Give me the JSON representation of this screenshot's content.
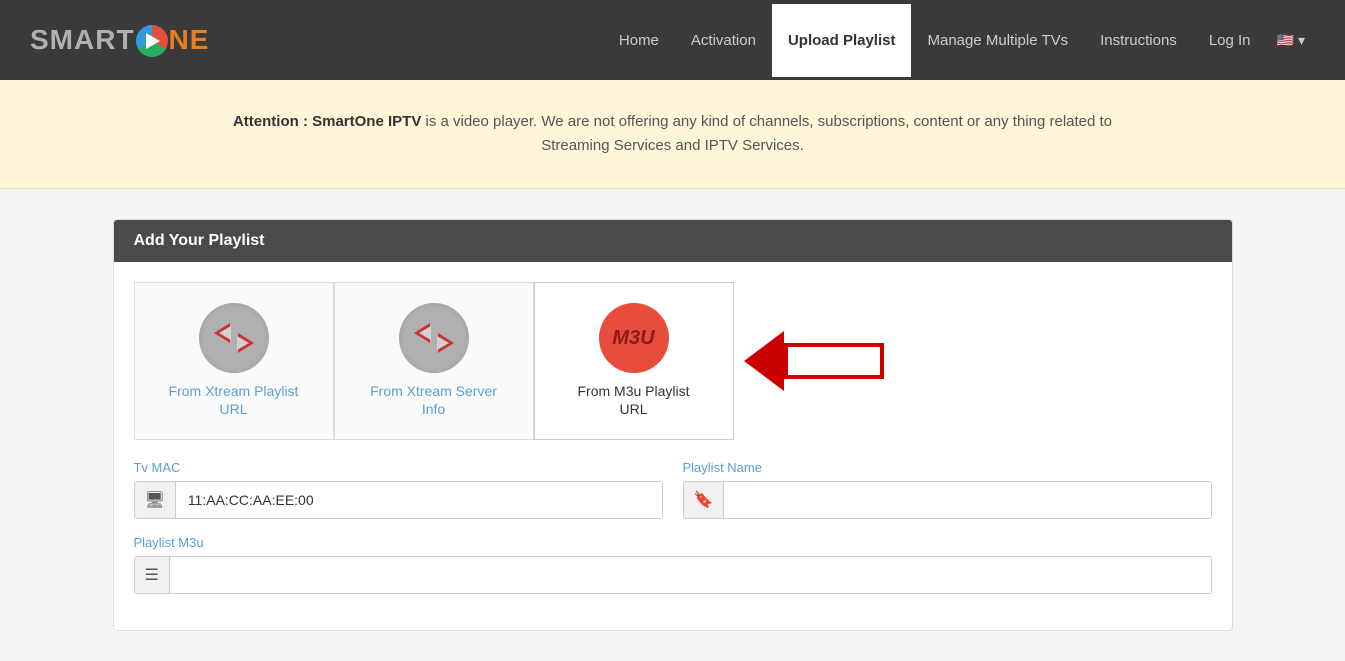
{
  "navbar": {
    "logo": {
      "smart": "SMART",
      "ne": "NE"
    },
    "links": [
      {
        "id": "home",
        "label": "Home",
        "active": false
      },
      {
        "id": "activation",
        "label": "Activation",
        "active": false
      },
      {
        "id": "upload-playlist",
        "label": "Upload Playlist",
        "active": true
      },
      {
        "id": "manage-tvs",
        "label": "Manage Multiple TVs",
        "active": false
      },
      {
        "id": "instructions",
        "label": "Instructions",
        "active": false
      },
      {
        "id": "login",
        "label": "Log In",
        "active": false
      }
    ],
    "language": "🇺🇸"
  },
  "banner": {
    "prefix": "Attention : ",
    "brand": "SmartOne IPTV",
    "text": " is a video player. We are not offering any kind of channels, subscriptions, content or any thing related to Streaming Services and IPTV Services."
  },
  "playlist_section": {
    "header": "Add Your Playlist",
    "tabs": [
      {
        "id": "xtream-url",
        "label": "From Xtream Playlist URL",
        "type": "xtream",
        "active": false
      },
      {
        "id": "xtream-server",
        "label": "From Xtream Server Info",
        "type": "xtream",
        "active": false
      },
      {
        "id": "m3u-url",
        "label": "From M3u Playlist URL",
        "type": "m3u",
        "active": true
      }
    ]
  },
  "form": {
    "tv_mac_label": "Tv MAC",
    "tv_mac_value": "11:AA:CC:AA:EE:00",
    "tv_mac_placeholder": "11:AA:CC:AA:EE:00",
    "playlist_name_label": "Playlist Name",
    "playlist_name_placeholder": "",
    "playlist_m3u_label": "Playlist M3u",
    "icons": {
      "tv": "🖥",
      "bookmark": "🔖",
      "list": "☰"
    }
  },
  "m3u_badge": "M3U"
}
